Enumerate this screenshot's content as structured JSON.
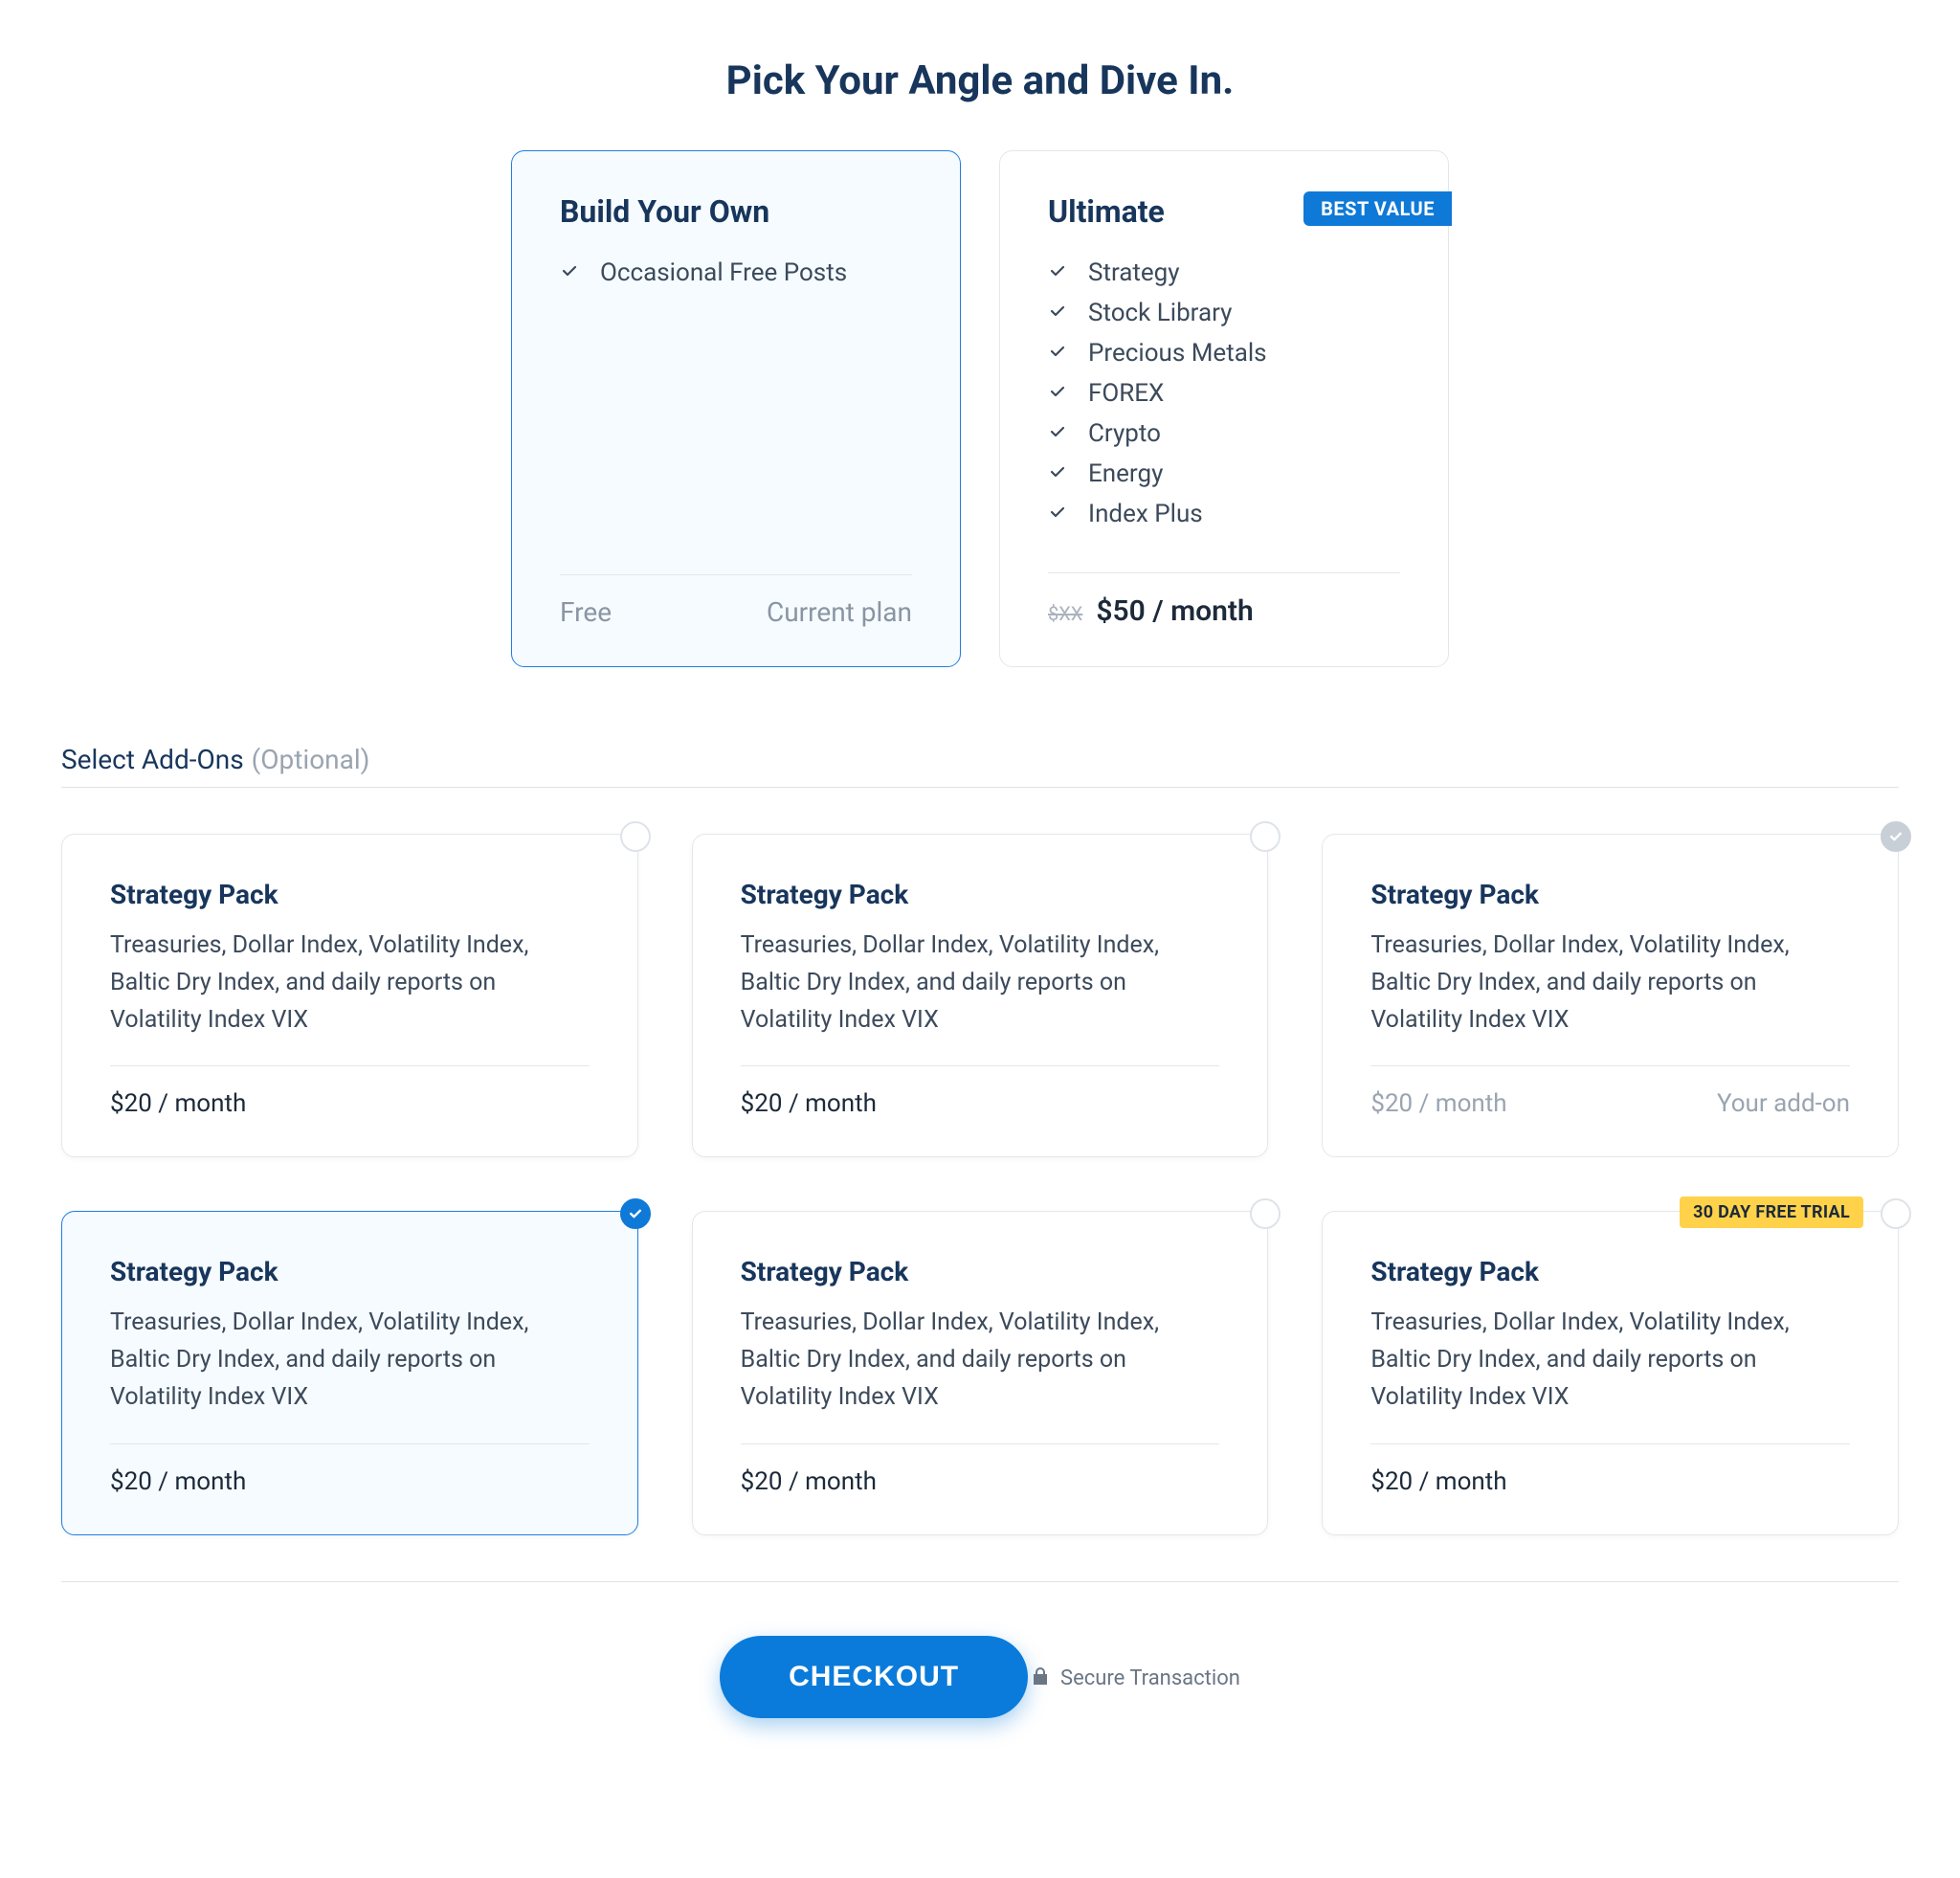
{
  "title": "Pick Your Angle and Dive In.",
  "plans": [
    {
      "name": "Build Your Own",
      "features": [
        "Occasional Free Posts"
      ],
      "price": "Free",
      "status": "Current plan",
      "selected": true,
      "best_value": false
    },
    {
      "name": "Ultimate",
      "features": [
        "Strategy",
        "Stock Library",
        "Precious Metals",
        "FOREX",
        "Crypto",
        "Energy",
        "Index Plus"
      ],
      "old_price": "$XX",
      "price": "$50 / month",
      "status": "",
      "selected": false,
      "best_value": true
    }
  ],
  "best_value_label": "BEST VALUE",
  "addons": {
    "heading": "Select Add-Ons",
    "optional": "(Optional)",
    "items": [
      {
        "title": "Strategy Pack",
        "desc": "Treasuries, Dollar Index, Volatility Index, Baltic Dry Index, and daily reports on Volatility Index VIX",
        "price": "$20 / month",
        "state": "default"
      },
      {
        "title": "Strategy Pack",
        "desc": "Treasuries, Dollar Index, Volatility Index, Baltic Dry Index, and daily reports on Volatility Index VIX",
        "price": "$20 / month",
        "state": "default"
      },
      {
        "title": "Strategy Pack",
        "desc": "Treasuries, Dollar Index, Volatility Index, Baltic Dry Index, and daily reports on Volatility Index VIX",
        "price": "$20 / month",
        "state": "owned",
        "owned_label": "Your add-on"
      },
      {
        "title": "Strategy Pack",
        "desc": "Treasuries, Dollar Index, Volatility Index, Baltic Dry Index, and daily reports on Volatility Index VIX",
        "price": "$20 / month",
        "state": "selected"
      },
      {
        "title": "Strategy Pack",
        "desc": "Treasuries, Dollar Index, Volatility Index, Baltic Dry Index, and daily reports on Volatility Index VIX",
        "price": "$20 / month",
        "state": "default"
      },
      {
        "title": "Strategy Pack",
        "desc": "Treasuries, Dollar Index, Volatility Index, Baltic Dry Index, and daily reports on Volatility Index VIX",
        "price": "$20 / month",
        "state": "default",
        "badge": "30 DAY FREE TRIAL"
      }
    ]
  },
  "checkout_label": "CHECKOUT",
  "secure_label": "Secure Transaction"
}
